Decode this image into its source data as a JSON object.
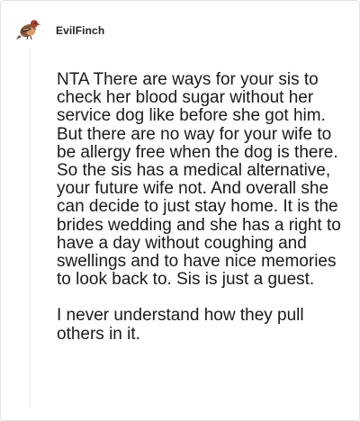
{
  "post": {
    "username": "EvilFinch",
    "avatar_icon": "finch-bird-icon",
    "paragraphs": [
      "NTA There are ways for your sis to check her blood sugar without her service dog like before she got him. But there are no way for your wife to be allergy free when the dog is there. So the sis has a medical alternative, your future wife not. And overall she can decide to just stay home. It is the brides wedding and she has a right to have a day without coughing and swellings and to have nice memories to look back to. Sis is just a guest.",
      "I never understand how they pull others in it."
    ]
  },
  "colors": {
    "text": "#1a1a1a",
    "border": "#e3e3e3",
    "thread_line": "#e6e6e6",
    "bird_body": "#8a5a3c",
    "bird_breast": "#d99a6c"
  }
}
